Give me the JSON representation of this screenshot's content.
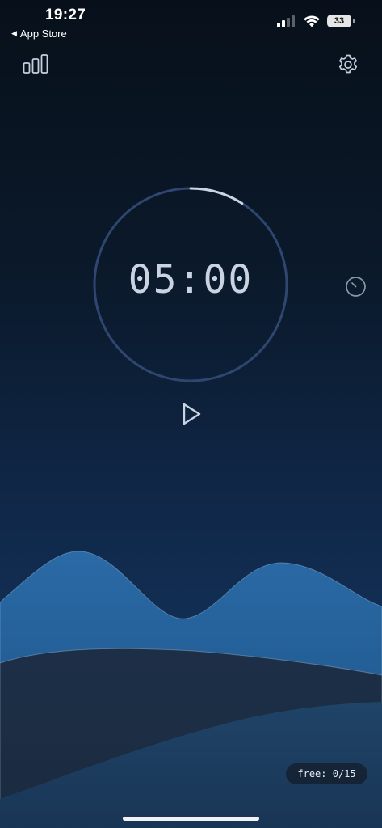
{
  "status_bar": {
    "time": "19:27",
    "back_label": "App Store",
    "back_glyph": "◀",
    "battery": "33",
    "icons": [
      "cellular-signal-icon",
      "wifi-icon",
      "battery-icon"
    ]
  },
  "header": {
    "left_icon": "stats-bars-icon",
    "right_icon": "gear-icon"
  },
  "timer": {
    "display": "05:00",
    "progress": 0.09,
    "play_icon": "play-icon",
    "side_icon": "stopwatch-icon"
  },
  "footer": {
    "free_label": "free: 0/15"
  },
  "colors": {
    "ring_track": "#2e4670",
    "ring_progress": "#c9d3e2",
    "timer_text": "#c9d3e2",
    "mountain_front": "#1f5f97",
    "hill_dark": "#1a2e47",
    "hill_mid": "#1c3a5c"
  }
}
